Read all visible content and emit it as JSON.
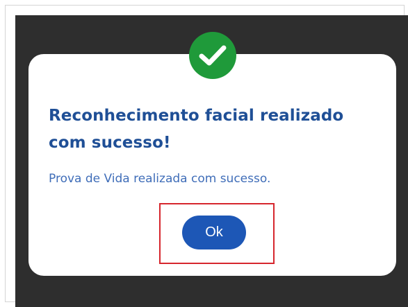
{
  "dialog": {
    "title": "Reconhecimento facial realizado com sucesso!",
    "message": "Prova de Vida realizada com sucesso.",
    "ok_label": "Ok",
    "icon": "check-icon"
  },
  "colors": {
    "backdrop": "#2e2e2e",
    "dialog_bg": "#ffffff",
    "success": "#1f9a3a",
    "title": "#1f4f96",
    "message": "#3f6db8",
    "button": "#1d57b6",
    "highlight": "#d6262d"
  }
}
